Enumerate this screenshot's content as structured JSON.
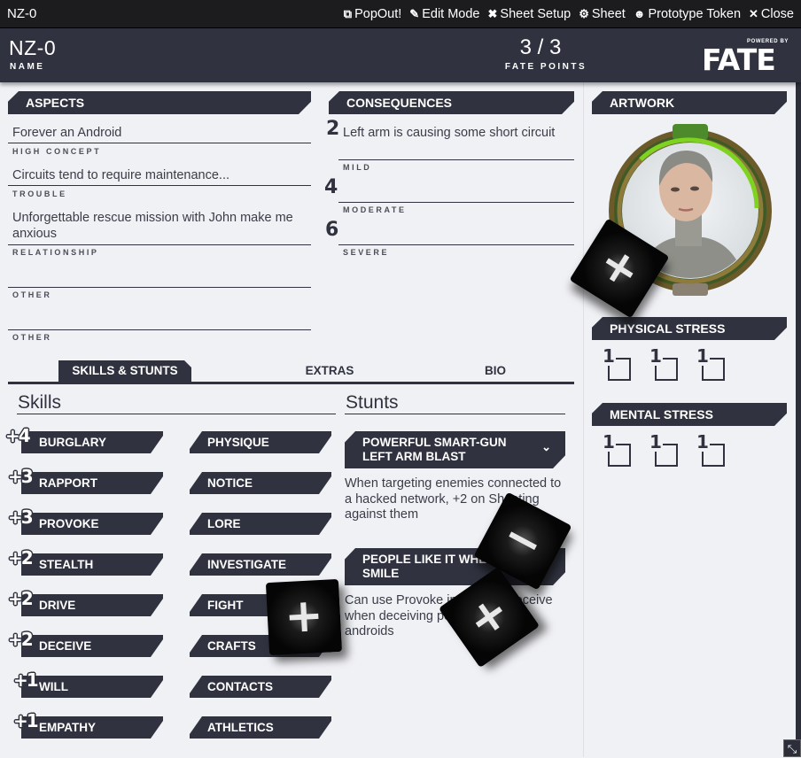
{
  "window": {
    "title": "NZ-0",
    "buttons": [
      {
        "icon": "external-link-icon",
        "glyph": "⧉",
        "label": "PopOut!"
      },
      {
        "icon": "edit-icon",
        "glyph": "✎",
        "label": "Edit Mode"
      },
      {
        "icon": "tools-icon",
        "glyph": "✖",
        "label": "Sheet Setup"
      },
      {
        "icon": "gear-icon",
        "glyph": "⚙",
        "label": "Sheet"
      },
      {
        "icon": "user-circle-icon",
        "glyph": "☻",
        "label": "Prototype Token"
      },
      {
        "icon": "close-icon",
        "glyph": "✕",
        "label": "Close"
      }
    ]
  },
  "header": {
    "name": "NZ-0",
    "name_label": "NAME",
    "fate_points": "3 / 3",
    "fate_points_label": "FATE POINTS",
    "logo_powered": "POWERED BY",
    "logo_text": "FATE"
  },
  "aspects": {
    "title": "ASPECTS",
    "items": [
      {
        "value": "Forever an Android",
        "label": "HIGH CONCEPT"
      },
      {
        "value": "Circuits tend to require maintenance...",
        "label": "TROUBLE"
      },
      {
        "value": "Unforgettable rescue mission with John make me anxious",
        "label": "RELATIONSHIP"
      },
      {
        "value": "",
        "label": "OTHER"
      },
      {
        "value": "",
        "label": "OTHER"
      }
    ]
  },
  "consequences": {
    "title": "CONSEQUENCES",
    "items": [
      {
        "value_num": "2",
        "value": "Left arm is causing some short circuit",
        "label": "MILD"
      },
      {
        "value_num": "4",
        "value": "",
        "label": "MODERATE"
      },
      {
        "value_num": "6",
        "value": "",
        "label": "SEVERE"
      }
    ]
  },
  "artwork": {
    "title": "ARTWORK"
  },
  "physical_stress": {
    "title": "PHYSICAL STRESS",
    "boxes": [
      "1",
      "1",
      "1"
    ]
  },
  "mental_stress": {
    "title": "MENTAL STRESS",
    "boxes": [
      "1",
      "1",
      "1"
    ]
  },
  "tabs": [
    {
      "label": "SKILLS & STUNTS",
      "active": true
    },
    {
      "label": "EXTRAS",
      "active": false
    },
    {
      "label": "BIO",
      "active": false
    }
  ],
  "skills": {
    "title": "Skills",
    "left": [
      {
        "rank": "+4",
        "name": "BURGLARY"
      },
      {
        "rank": "+3",
        "name": "RAPPORT"
      },
      {
        "rank": "+3",
        "name": "PROVOKE"
      },
      {
        "rank": "+2",
        "name": "STEALTH"
      },
      {
        "rank": "+2",
        "name": "DRIVE"
      },
      {
        "rank": "+2",
        "name": "DECEIVE"
      },
      {
        "rank": "+1",
        "name": "WILL"
      },
      {
        "rank": "+1",
        "name": "EMPATHY"
      }
    ],
    "right": [
      {
        "name": "PHYSIQUE"
      },
      {
        "name": "NOTICE"
      },
      {
        "name": "LORE"
      },
      {
        "name": "INVESTIGATE"
      },
      {
        "name": "FIGHT"
      },
      {
        "name": "CRAFTS"
      },
      {
        "name": "CONTACTS"
      },
      {
        "name": "ATHLETICS"
      }
    ]
  },
  "stunts": {
    "title": "Stunts",
    "items": [
      {
        "name": "POWERFUL SMART-GUN LEFT ARM BLAST",
        "description": "When targeting enemies connected to a hacked network, +2 on Shooting against them"
      },
      {
        "name": "PEOPLE LIKE IT WHEN I SMILE",
        "description": "Can use Provoke instead of Deceive when deceiving people who are androids"
      }
    ]
  },
  "dice": [
    "+",
    "−",
    "+",
    "+"
  ]
}
